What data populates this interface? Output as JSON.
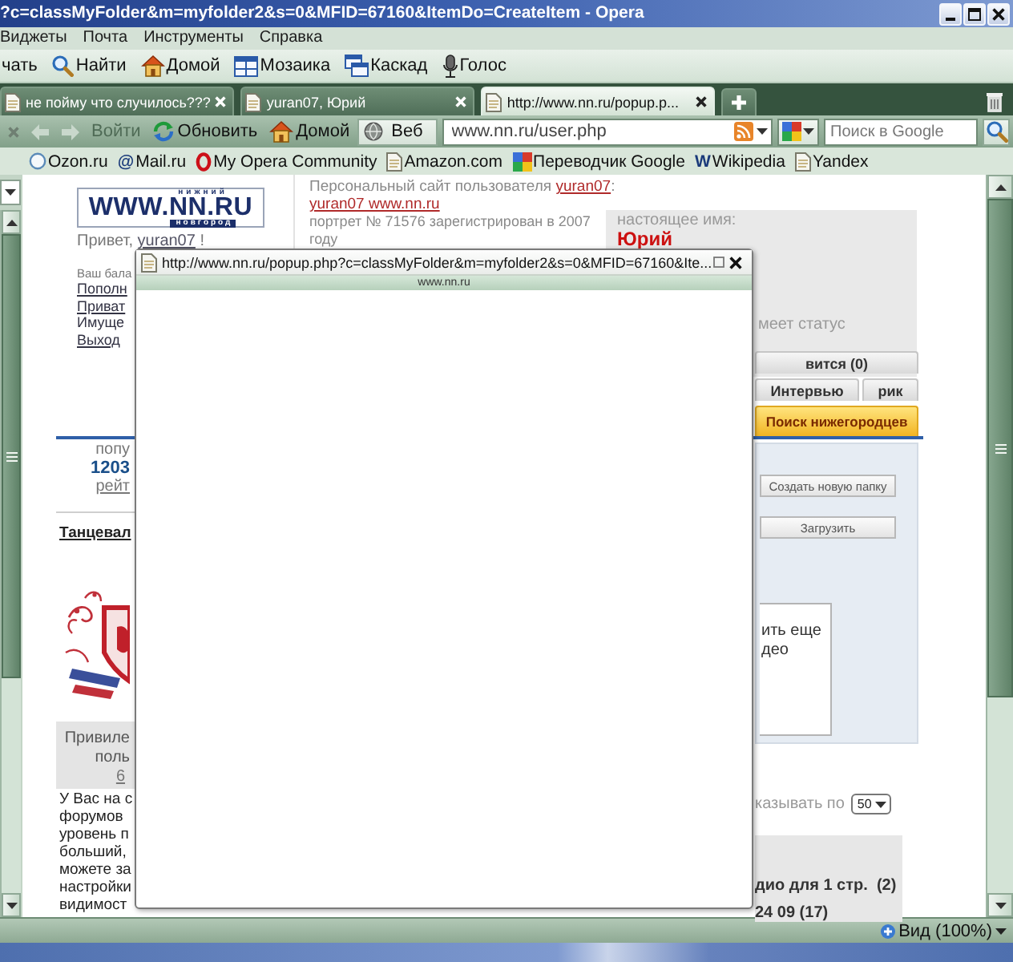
{
  "window": {
    "title": "?c=classMyFolder&m=myfolder2&s=0&MFID=67160&ItemDo=CreateItem - Opera"
  },
  "menu": [
    "Виджеты",
    "Почта",
    "Инструменты",
    "Справка"
  ],
  "toolbar": [
    {
      "kind": "text",
      "label": "чать"
    },
    {
      "kind": "search",
      "label": "Найти"
    },
    {
      "kind": "home",
      "label": "Домой"
    },
    {
      "kind": "tile",
      "label": "Мозаика"
    },
    {
      "kind": "cascade",
      "label": "Каскад"
    },
    {
      "kind": "voice",
      "label": "Голос"
    }
  ],
  "tabs": [
    {
      "label": "не пойму что случилось???",
      "selected": false
    },
    {
      "label": "yuran07, Юрий",
      "selected": false
    },
    {
      "label": "http://www.nn.ru/popup.p...",
      "selected": true
    }
  ],
  "nav": {
    "buttons": [
      {
        "kind": "back",
        "disabled": true
      },
      {
        "kind": "forward",
        "disabled": true
      },
      {
        "kind": "login",
        "label": "Войти",
        "disabled": true
      },
      {
        "kind": "reload",
        "label": "Обновить",
        "disabled": false
      },
      {
        "kind": "home",
        "label": "Домой",
        "disabled": false
      }
    ],
    "engine": "Веб",
    "address": "www.nn.ru/user.php",
    "search": {
      "placeholder": "Поиск в Google"
    }
  },
  "bookmarks": [
    {
      "kind": "circle",
      "label": "Ozon.ru"
    },
    {
      "kind": "glyph",
      "glyph": "@",
      "label": "Mail.ru"
    },
    {
      "kind": "ring",
      "label": "My Opera Community"
    },
    {
      "kind": "page",
      "label": "Amazon.com"
    },
    {
      "kind": "google",
      "label": "Переводчик Google"
    },
    {
      "kind": "glyph",
      "glyph": "W",
      "label": "Wikipedia"
    },
    {
      "kind": "page",
      "label": "Yandex"
    }
  ],
  "page": {
    "logo": {
      "top": "нижний",
      "main": "WWW.NN.RU",
      "bottom": "новгород"
    },
    "greeting": {
      "prefix": "Привет,",
      "user": "yuran07",
      "suffix": "!"
    },
    "balance_label": "Ваш бала",
    "account_links": [
      {
        "label": "Пополн",
        "kind": "link"
      },
      {
        "label": "Приват",
        "kind": "link"
      },
      {
        "label": "Имуще",
        "kind": "text"
      },
      {
        "label": "Выход",
        "kind": "link"
      }
    ],
    "site": {
      "prefix": "Персональный сайт пользователя",
      "user": "yuran07",
      "suffix": ":",
      "link": "yuran07 www.nn.ru",
      "portrait_lines": [
        "портрет № 71576 зарегистрирован в 2007",
        "году"
      ]
    },
    "real_name": {
      "label": "настоящее имя:",
      "name": "Юрий",
      "status": "меет статус"
    },
    "profile_tabs": [
      {
        "label": "вится (0)",
        "kind": "tab"
      },
      {
        "label": "Интервью",
        "kind": "tab"
      },
      {
        "label": "рик",
        "kind": "tab"
      },
      {
        "label": "Поиск нижегородцев",
        "kind": "promo"
      }
    ],
    "popularity": {
      "label": "попу",
      "value": "1203",
      "link": "рейт"
    },
    "dance_title": "Танцевал",
    "privilege": {
      "lines": [
        "Привиле",
        "поль"
      ],
      "link": "6"
    },
    "info_lines": [
      "У Вас на с",
      "форумов",
      "уровень п",
      "больший,",
      "можете за",
      "настройки",
      "видимост"
    ],
    "folder_actions": [
      "Создать новую папку",
      "Загрузить"
    ],
    "note_lines": [
      "ить еще",
      "део"
    ],
    "per_page": {
      "label": "казывать по",
      "value": "50"
    },
    "albums": [
      "дио для 1 стр.  (2)",
      "24 09 (17)"
    ]
  },
  "popup": {
    "title": "http://www.nn.ru/popup.php?c=classMyFolder&m=myfolder2&s=0&MFID=67160&Ite...",
    "host": "www.nn.ru"
  },
  "status_bar": {
    "zoom": "Вид (100%)"
  }
}
